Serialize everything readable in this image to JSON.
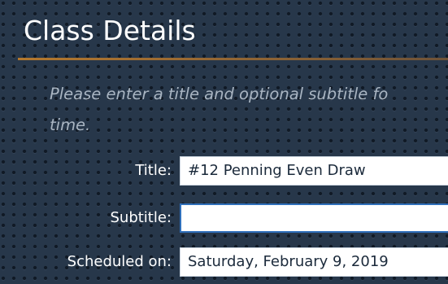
{
  "window": {
    "title": "Class Details"
  },
  "instructions": {
    "line1": "Please enter a title and optional subtitle fo",
    "line2": "time."
  },
  "form": {
    "title": {
      "label": "Title:",
      "value": "#12 Penning Even Draw"
    },
    "subtitle": {
      "label": "Subtitle:",
      "value": ""
    },
    "scheduled": {
      "label": "Scheduled on:",
      "value": "Saturday, February 9, 2019"
    }
  },
  "colors": {
    "background": "#27374a",
    "accent_rule": "#b4782d",
    "instructions_text": "#a9b5c2",
    "focus_border": "#2f6fba"
  }
}
